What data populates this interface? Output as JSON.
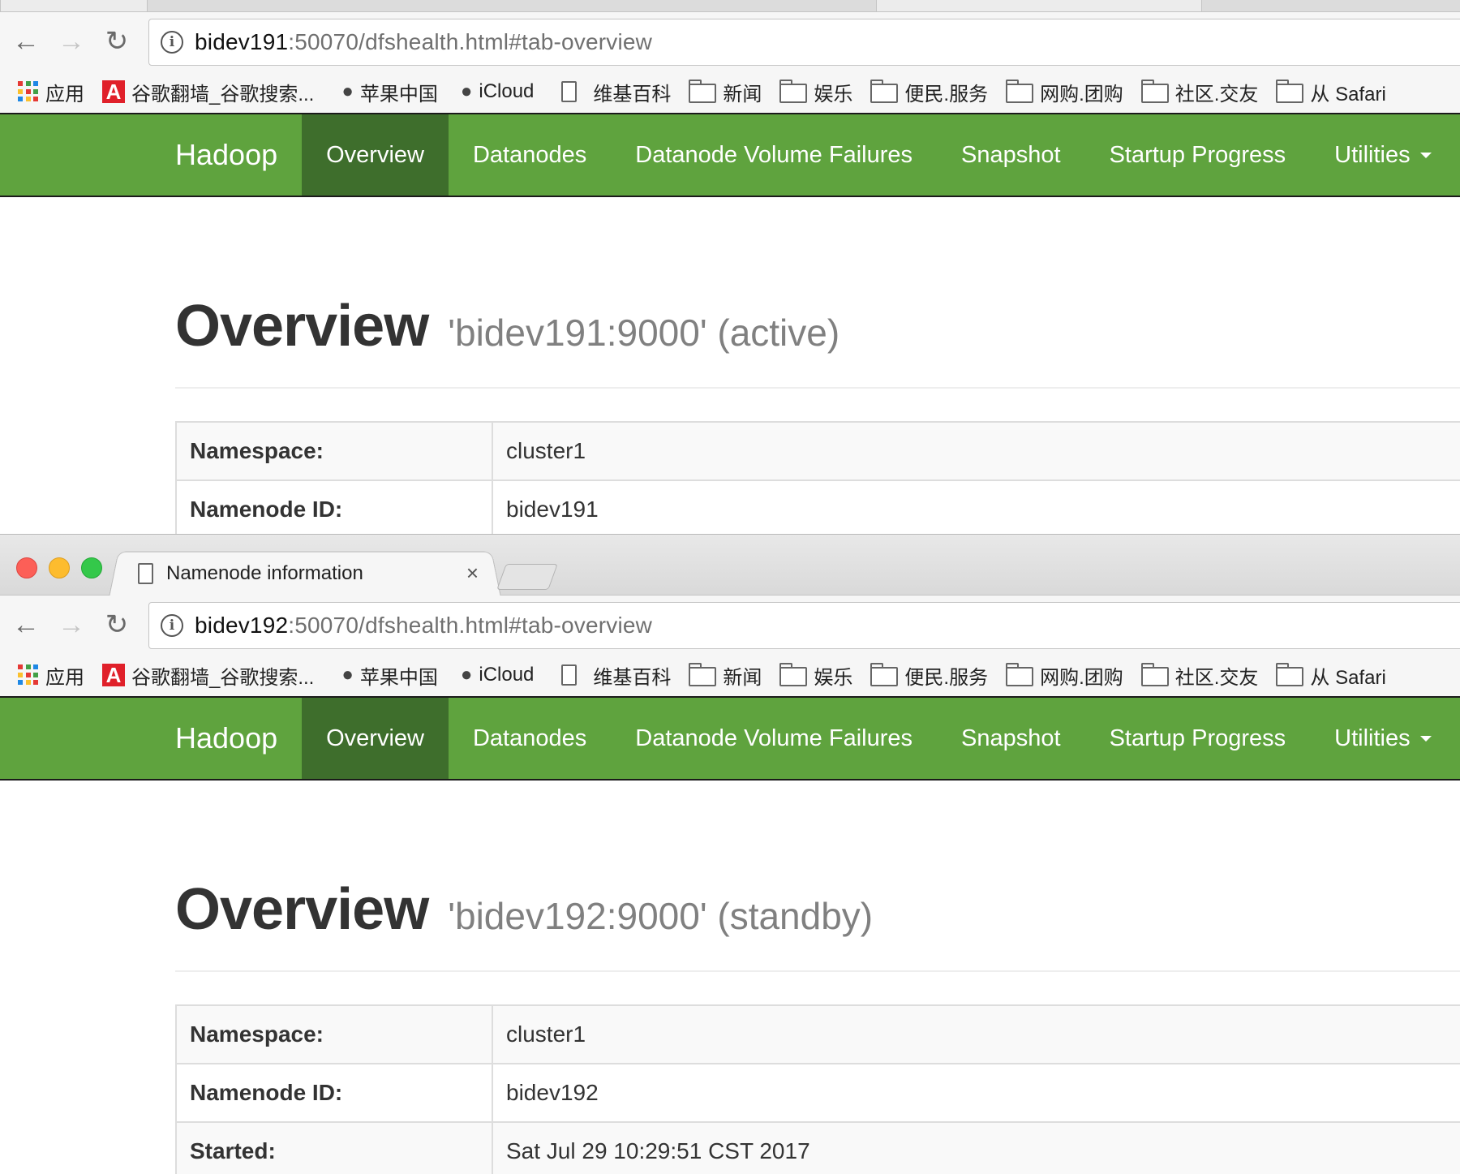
{
  "window1": {
    "url": {
      "host": "bidev191",
      "rest": ":50070/dfshealth.html#tab-overview"
    },
    "overview": {
      "title": "Overview",
      "subtitle": "'bidev191:9000' (active)"
    },
    "rows": [
      {
        "key": "Namespace:",
        "value": "cluster1"
      },
      {
        "key": "Namenode ID:",
        "value": "bidev191"
      }
    ]
  },
  "window2": {
    "tab_title": "Namenode information",
    "tab_close": "×",
    "url": {
      "host": "bidev192",
      "rest": ":50070/dfshealth.html#tab-overview"
    },
    "overview": {
      "title": "Overview",
      "subtitle": "'bidev192:9000' (standby)"
    },
    "rows": [
      {
        "key": "Namespace:",
        "value": "cluster1"
      },
      {
        "key": "Namenode ID:",
        "value": "bidev192"
      },
      {
        "key": "Started:",
        "value": "Sat Jul 29 10:29:51 CST 2017"
      }
    ]
  },
  "bookmarks": [
    {
      "label": "应用",
      "icon": "apps-grid-icon"
    },
    {
      "label": "谷歌翻墙_谷歌搜索...",
      "icon": "a-logo-icon"
    },
    {
      "label": "苹果中国",
      "icon": "apple-icon"
    },
    {
      "label": "iCloud",
      "icon": "apple-icon"
    },
    {
      "label": "维基百科",
      "icon": "document-icon"
    },
    {
      "label": "新闻",
      "icon": "folder-icon"
    },
    {
      "label": "娱乐",
      "icon": "folder-icon"
    },
    {
      "label": "便民.服务",
      "icon": "folder-icon"
    },
    {
      "label": "网购.团购",
      "icon": "folder-icon"
    },
    {
      "label": "社区.交友",
      "icon": "folder-icon"
    },
    {
      "label": "从 Safari",
      "icon": "folder-icon"
    }
  ],
  "navbar": {
    "brand": "Hadoop",
    "items": [
      "Overview",
      "Datanodes",
      "Datanode Volume Failures",
      "Snapshot",
      "Startup Progress",
      "Utilities"
    ]
  },
  "icons": {
    "back": "←",
    "forward": "→",
    "reload": "↻",
    "info": "i",
    "apple": ""
  },
  "colors": {
    "navbar_green": "#5fa33e",
    "navbar_active": "#3e6e2c",
    "accent_red_logo": "#e0202a"
  }
}
